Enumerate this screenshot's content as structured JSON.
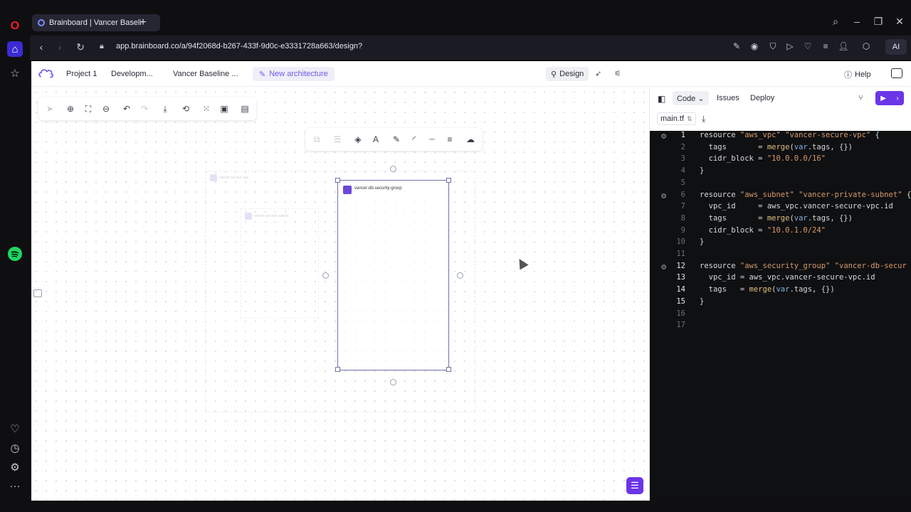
{
  "browser": {
    "tab_title": "Brainboard | Vancer Baseli",
    "url": "app.brainboard.co/a/94f2068d-b267-433f-9d0c-e3331728a663/design?",
    "ai_label": "AI"
  },
  "app": {
    "breadcrumbs": [
      "Project 1",
      "Developm...",
      "Vancer Baseline ..."
    ],
    "new_architecture": "New architecture",
    "design_label": "Design",
    "help_label": "Help"
  },
  "canvas": {
    "vpc_label": "vancer-secure-vpc",
    "subnet_label": "vancer-private-subnet",
    "sg_label": "vancer-db-security-group"
  },
  "panel": {
    "tabs": [
      "Code",
      "Issues",
      "Deploy"
    ],
    "active_tab": "Code",
    "file_name": "main.tf",
    "code_lines": [
      "resource \"aws_vpc\" \"vancer-secure-vpc\" {",
      "  tags       = merge(var.tags, {})",
      "  cidr_block = \"10.0.0.0/16\"",
      "}",
      "",
      "resource \"aws_subnet\" \"vancer-private-subnet\" {",
      "  vpc_id     = aws_vpc.vancer-secure-vpc.id",
      "  tags       = merge(var.tags, {})",
      "  cidr_block = \"10.0.1.0/24\"",
      "}",
      "",
      "resource \"aws_security_group\" \"vancer-db-secur",
      "  vpc_id = aws_vpc.vancer-secure-vpc.id",
      "  tags   = merge(var.tags, {})",
      "}",
      "",
      ""
    ]
  },
  "icons": {
    "opera": "opera-logo-icon",
    "spotify": "spotify-icon",
    "fab": "menu-icon"
  },
  "colors": {
    "accent": "#6b35e8",
    "selection": "#6f73a8",
    "code_bg": "#0f1012"
  }
}
